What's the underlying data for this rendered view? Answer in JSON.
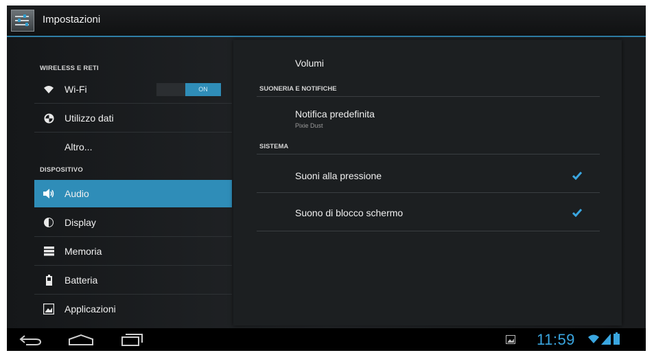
{
  "header": {
    "title": "Impostazioni",
    "icon": "settings-app-icon"
  },
  "sidebar": {
    "sections": [
      {
        "label": "WIRELESS E RETI"
      },
      {
        "label": "DISPOSITIVO"
      }
    ],
    "items": [
      {
        "label": "Wi-Fi",
        "icon": "wifi-icon",
        "toggle": "ON"
      },
      {
        "label": "Utilizzo dati",
        "icon": "data-usage-icon"
      },
      {
        "label": "Altro...",
        "icon": ""
      },
      {
        "label": "Audio",
        "icon": "speaker-icon",
        "selected": true
      },
      {
        "label": "Display",
        "icon": "brightness-icon"
      },
      {
        "label": "Memoria",
        "icon": "storage-icon"
      },
      {
        "label": "Batteria",
        "icon": "battery-icon"
      },
      {
        "label": "Applicazioni",
        "icon": "apps-icon"
      }
    ]
  },
  "main": {
    "volumi": "Volumi",
    "sections": [
      {
        "label": "SUONERIA E NOTIFICHE"
      },
      {
        "label": "SISTEMA"
      }
    ],
    "notification": {
      "title": "Notifica predefinita",
      "value": "Pixie Dust"
    },
    "options": [
      {
        "label": "Suoni alla pressione",
        "checked": true
      },
      {
        "label": "Suono di blocco schermo",
        "checked": true
      }
    ]
  },
  "statusbar": {
    "time": "11:59",
    "accent": "#3aa6e0"
  },
  "colors": {
    "accent": "#2f8db8",
    "background": "#0e0f10"
  }
}
